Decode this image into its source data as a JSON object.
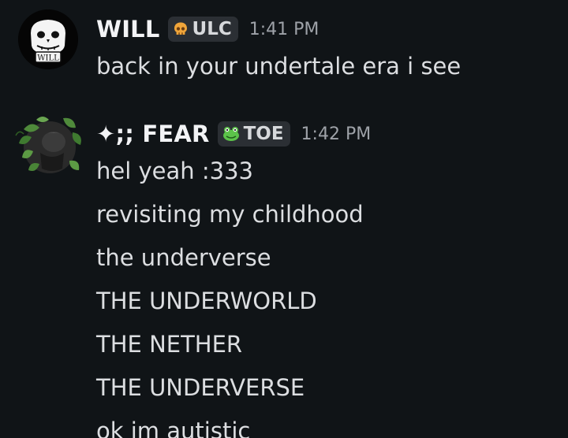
{
  "messages": [
    {
      "username": "WILL",
      "tag": {
        "icon": "skull-icon",
        "label": "ULC"
      },
      "time": "1:41 PM",
      "lines": [
        "back in your undertale era i see"
      ],
      "avatar_text": "WILL"
    },
    {
      "username": "✦;; FEAR",
      "tag": {
        "icon": "frog-icon",
        "label": "TOE"
      },
      "time": "1:42 PM",
      "lines": [
        "hel yeah :333",
        "revisiting my childhood",
        "the underverse",
        "THE UNDERWORLD",
        "THE NETHER",
        "THE UNDERVERSE",
        "ok im autistic"
      ]
    }
  ],
  "colors": {
    "background": "#101417",
    "username": "#f2f3f5",
    "message_text": "#dcdee1",
    "timestamp": "#9ea2a8",
    "tag_background": "#2b2f34"
  }
}
